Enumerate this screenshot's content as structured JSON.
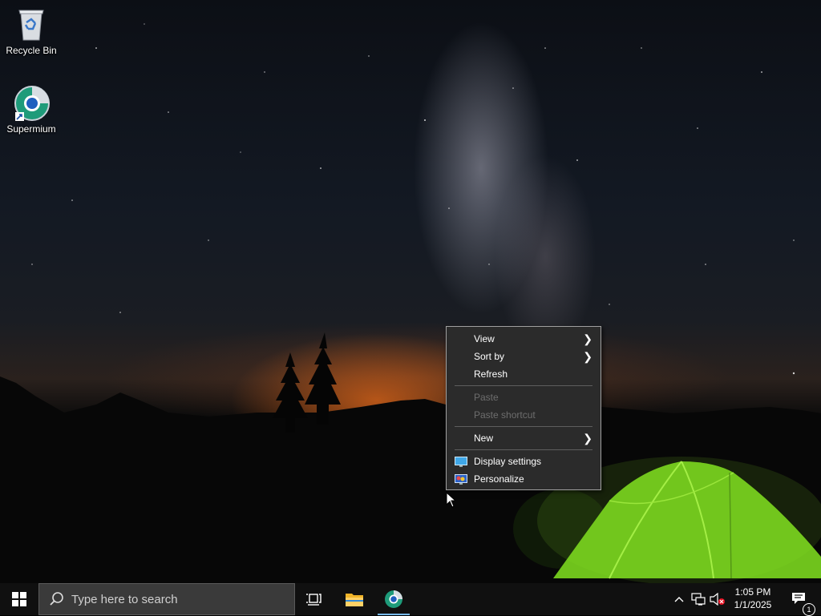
{
  "desktop": {
    "icons": [
      {
        "label": "Recycle Bin",
        "icon": "recycle-bin-icon"
      },
      {
        "label": "Supermium",
        "icon": "supermium-browser-icon"
      }
    ]
  },
  "context_menu": {
    "items": [
      {
        "label": "View",
        "has_submenu": true,
        "enabled": true
      },
      {
        "label": "Sort by",
        "has_submenu": true,
        "enabled": true
      },
      {
        "label": "Refresh",
        "has_submenu": false,
        "enabled": true
      },
      {
        "label": "Paste",
        "has_submenu": false,
        "enabled": false
      },
      {
        "label": "Paste shortcut",
        "has_submenu": false,
        "enabled": false
      },
      {
        "label": "New",
        "has_submenu": true,
        "enabled": true
      },
      {
        "label": "Display settings",
        "has_submenu": false,
        "enabled": true,
        "icon": "display-icon"
      },
      {
        "label": "Personalize",
        "has_submenu": false,
        "enabled": true,
        "icon": "personalize-icon"
      }
    ]
  },
  "taskbar": {
    "search_placeholder": "Type here to search",
    "clock": {
      "time": "1:05 PM",
      "date": "1/1/2025"
    },
    "notification_count": "1",
    "pinned": [
      "task-view-icon",
      "file-explorer-icon",
      "supermium-browser-icon"
    ],
    "tray_icons": [
      "chevron-up-icon",
      "network-icon",
      "volume-muted-icon"
    ]
  },
  "colors": {
    "taskbar_bg": "#101010",
    "menu_bg": "#2b2b2b",
    "active_indicator": "#76b9ed",
    "tent_green": "#7ed321"
  }
}
